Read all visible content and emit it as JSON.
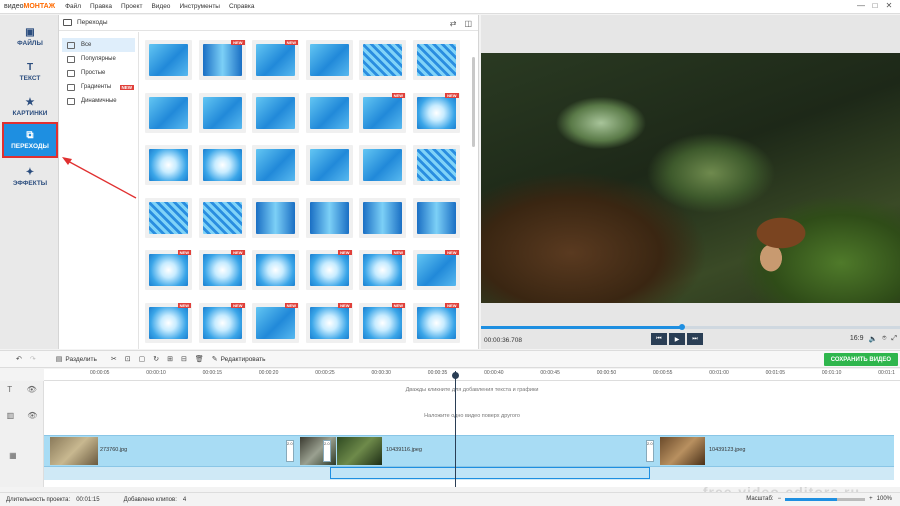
{
  "app": {
    "logo_prefix": "видео",
    "logo_brand": "МОНТАЖ"
  },
  "menu": [
    "Файл",
    "Правка",
    "Проект",
    "Видео",
    "Инструменты",
    "Справка"
  ],
  "window_controls": [
    "—",
    "□",
    "✕"
  ],
  "leftnav": [
    {
      "label": "ФАЙЛЫ",
      "icon": "files-icon",
      "active": false
    },
    {
      "label": "ТЕКСТ",
      "icon": "text-icon",
      "active": false
    },
    {
      "label": "КАРТИНКИ",
      "icon": "star-icon",
      "active": false
    },
    {
      "label": "ПЕРЕХОДЫ",
      "icon": "transitions-icon",
      "active": true
    },
    {
      "label": "ЭФФЕКТЫ",
      "icon": "effects-icon",
      "active": false
    }
  ],
  "panel": {
    "title": "Переходы",
    "categories": [
      {
        "label": "Все",
        "active": true,
        "new": false
      },
      {
        "label": "Популярные",
        "active": false,
        "new": false
      },
      {
        "label": "Простые",
        "active": false,
        "new": false
      },
      {
        "label": "Градиенты",
        "active": false,
        "new": true
      },
      {
        "label": "Динамичные",
        "active": false,
        "new": false
      }
    ],
    "new_badge": "NEW"
  },
  "preview": {
    "timecode": "00:00:36.708",
    "aspect": "16:9",
    "progress": 0.48
  },
  "toolbar": {
    "split_label": "Разделить",
    "edit_label": "Редактировать",
    "save_label": "СОХРАНИТЬ ВИДЕО"
  },
  "ruler": [
    "00:00:05",
    "00:00:10",
    "00:00:15",
    "00:00:20",
    "00:00:25",
    "00:00:30",
    "00:00:35",
    "00:00:40",
    "00:00:45",
    "00:00:50",
    "00:00:55",
    "00:01:00",
    "00:01:05",
    "00:01:10",
    "00:01:1"
  ],
  "timeline": {
    "text_hint": "Дважды кликните для добавления текста и графики",
    "overlay_hint": "Наложите одно видео поверх другого",
    "clips": [
      "273760.jpg",
      "10439116.jpeg",
      "10439123.jpeg"
    ],
    "transition_marks": [
      "2.0",
      "2.0",
      "2.0"
    ]
  },
  "status": {
    "duration_label": "Длительность проекта:",
    "duration_value": "00:01:15",
    "clips_label": "Добавлено клипов:",
    "clips_value": "4",
    "zoom_label": "Масштаб:",
    "zoom_value": "100%"
  },
  "watermark": "free-video-editors.ru",
  "colors": {
    "accent": "#1e8fe1",
    "save": "#2fb64d",
    "highlight": "#e03030",
    "new_badge": "#e0403a"
  }
}
